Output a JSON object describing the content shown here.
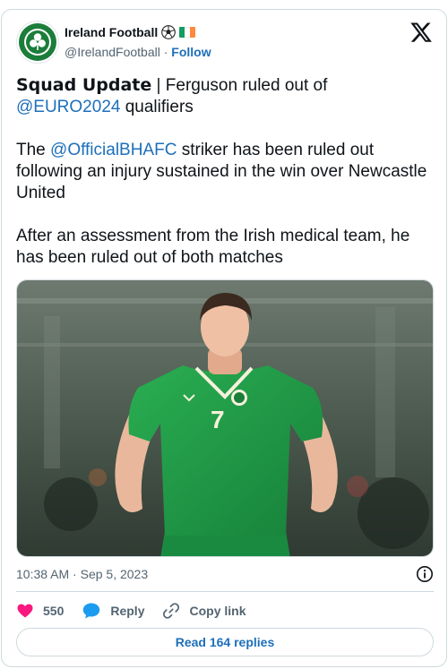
{
  "author": {
    "name": "Ireland Football",
    "handle": "@IrelandFootball",
    "separator": "·",
    "follow_label": "Follow",
    "flag_colors": [
      "#169b62",
      "#ffffff",
      "#ff883e"
    ]
  },
  "tweet": {
    "heading": "Squad Update",
    "line1_rest": " | Ferguson ruled out of ",
    "mention_euro": "@EURO2024",
    "line1_end": " qualifiers",
    "p2_start": "The ",
    "mention_club": "@OfficialBHAFC",
    "p2_end": " striker has been ruled out following an injury sustained in the win over Newcastle United",
    "p3": "After an assessment from the Irish medical team, he has been ruled out of both matches"
  },
  "photo": {
    "shirt_number": "7",
    "description_colors": {
      "kit": "#1f9a44",
      "background": "#3a4a3e"
    }
  },
  "meta": {
    "time": "10:38 AM",
    "separator": "·",
    "date": "Sep 5, 2023"
  },
  "actions": {
    "likes": "550",
    "reply_label": "Reply",
    "copy_label": "Copy link",
    "read_replies_label": "Read 164 replies"
  },
  "colors": {
    "link": "#1d6fba",
    "like": "#f91880",
    "reply": "#1d9bf0",
    "muted": "#536471"
  }
}
